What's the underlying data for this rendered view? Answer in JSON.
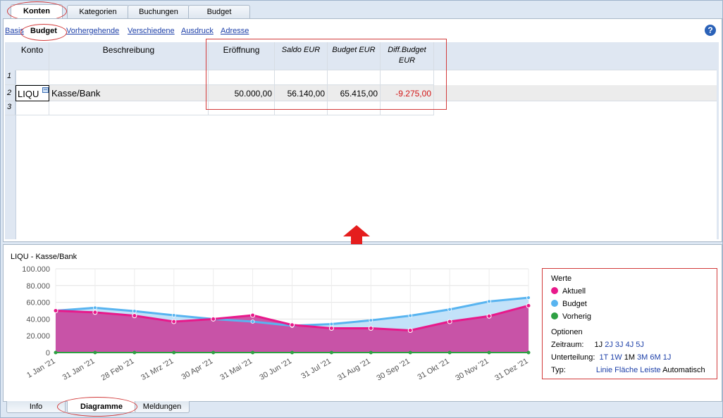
{
  "top_tabs": [
    "Konten",
    "Kategorien",
    "Buchungen",
    "Budget"
  ],
  "sub_tabs": [
    "Basis",
    "Budget",
    "Vorhergehende",
    "Verschiedene",
    "Ausdruck",
    "Adresse"
  ],
  "help": "?",
  "table": {
    "headers": [
      "Konto",
      "Beschreibung",
      "Eröffnung",
      "Saldo EUR",
      "Budget EUR",
      "Diff.Budget EUR"
    ],
    "rows": [
      {
        "n": "1",
        "konto": "",
        "beschreibung": "",
        "eroeffnung": "",
        "saldo": "",
        "budget": "",
        "diff": ""
      },
      {
        "n": "2",
        "konto": "LIQU",
        "beschreibung": "Kasse/Bank",
        "eroeffnung": "50.000,00",
        "saldo": "56.140,00",
        "budget": "65.415,00",
        "diff": "-9.275,00"
      },
      {
        "n": "3",
        "konto": "",
        "beschreibung": "",
        "eroeffnung": "",
        "saldo": "",
        "budget": "",
        "diff": ""
      }
    ]
  },
  "chart_title": "LIQU - Kasse/Bank",
  "chart_data": {
    "type": "area",
    "title": "LIQU - Kasse/Bank",
    "x": [
      "1 Jan '21",
      "31 Jan '21",
      "28 Feb '21",
      "31 Mrz '21",
      "30 Apr '21",
      "31 Mai '21",
      "30 Jun '21",
      "31 Jul '21",
      "31 Aug '21",
      "30 Sep '21",
      "31 Okt '21",
      "30 Nov '21",
      "31 Dez '21"
    ],
    "yticks": [
      "0",
      "20.000",
      "40.000",
      "60.000",
      "80.000",
      "100.000"
    ],
    "ylim": [
      0,
      100000
    ],
    "grid": true,
    "legend": "right",
    "series": [
      {
        "name": "Aktuell",
        "color": "#e8198b",
        "values": [
          50000,
          48000,
          44000,
          37000,
          40000,
          44500,
          33000,
          29000,
          29000,
          26500,
          37000,
          43500,
          56000
        ]
      },
      {
        "name": "Budget",
        "color": "#58b4f0",
        "values": [
          50000,
          53500,
          49500,
          44500,
          40000,
          37000,
          32000,
          34000,
          38500,
          44000,
          51500,
          61000,
          65500
        ]
      },
      {
        "name": "Vorherig",
        "color": "#2ea043",
        "values": [
          0,
          0,
          0,
          0,
          0,
          0,
          0,
          0,
          0,
          0,
          0,
          0,
          0
        ]
      }
    ]
  },
  "legend": {
    "werte_title": "Werte",
    "items": [
      {
        "label": "Aktuell",
        "color": "#e8198b"
      },
      {
        "label": "Budget",
        "color": "#58b4f0"
      },
      {
        "label": "Vorherig",
        "color": "#2ea043"
      }
    ],
    "optionen_title": "Optionen",
    "zeitraum_label": "Zeitraum:",
    "zeitraum": [
      "1J",
      "2J",
      "3J",
      "4J",
      "5J"
    ],
    "unterteilung_label": "Unterteilung:",
    "unterteilung": [
      "1T",
      "1W",
      "1M",
      "3M",
      "6M",
      "1J"
    ],
    "typ_label": "Typ:",
    "typ": [
      "Linie",
      "Fläche",
      "Leiste",
      "Automatisch"
    ]
  },
  "bottom_tabs": [
    "Info",
    "Diagramme",
    "Meldungen"
  ]
}
